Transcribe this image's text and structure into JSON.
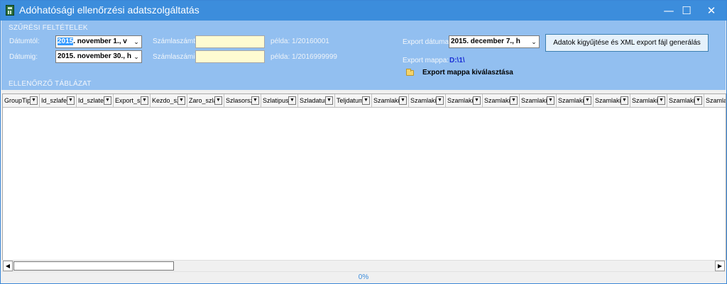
{
  "window": {
    "title": "Adóhatósági ellenőrzési adatszolgáltatás",
    "minimize": "—",
    "maximize": "☐",
    "close": "✕"
  },
  "filters": {
    "section_title": "SZŰRÉSI FELTÉTELEK",
    "date_from_label": "Dátumtól:",
    "date_from_sel": "2015",
    "date_from_rest": ".  november    1.,  v",
    "date_to_label": "Dátumig:",
    "date_to_value": "2015.  november  30.,  h",
    "invoice_from_label": "Számlaszámtól:",
    "invoice_from_value": "",
    "invoice_from_hint": "példa: 1/20160001",
    "invoice_to_label": "Számlaszámig:",
    "invoice_to_value": "",
    "invoice_to_hint": "példa: 1/2016999999",
    "export_date_label": "Export dátuma:",
    "export_date_value": "2015.  december   7.,     h",
    "generate_button": "Adatok kigyűjtése és XML export fájl generálás",
    "export_folder_label": "Export mappa:",
    "export_folder_value": "D:\\1\\",
    "select_folder": "Export mappa kiválasztása"
  },
  "grid": {
    "section_title": "ELLENŐRZŐ TÁBLÁZAT",
    "columns": [
      "GroupTip",
      "Id_szlafej",
      "Id_szlatet",
      "Export_sz",
      "Kezdo_sz",
      "Zaro_szla",
      "Szlasorsz",
      "Szlatipus",
      "Szladatum",
      "Teljdatum",
      "Szamlakil",
      "Szamlakil",
      "Szamlakil",
      "Szamlakil",
      "Szamlakil",
      "Szamlakil",
      "Szamlakil",
      "Szamlakil",
      "Szamlakil",
      "Szamla"
    ],
    "dropdown_glyph": "▼"
  },
  "scrollbar": {
    "left_arrow": "◀",
    "right_arrow": "▶"
  },
  "status": {
    "progress": "0%"
  },
  "colors": {
    "titlebar": "#3c8ddc",
    "filter_panel": "#92bff0",
    "input_yellow": "#fffbd1",
    "path_blue": "#1a2fd6"
  }
}
